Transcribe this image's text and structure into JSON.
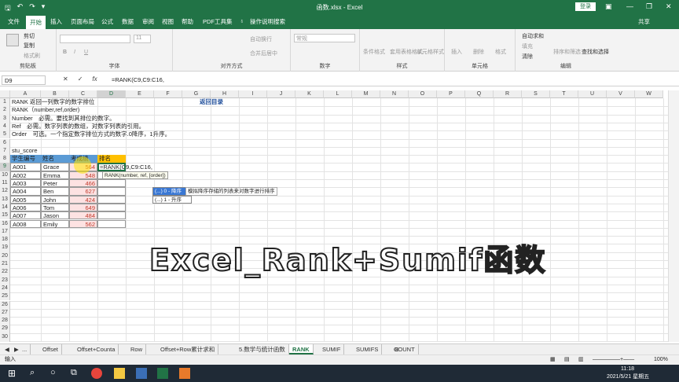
{
  "titlebar": {
    "file_title": "函数.xlsx - Excel",
    "login": "登录"
  },
  "ribbon_tabs": [
    "文件",
    "开始",
    "插入",
    "页面布局",
    "公式",
    "数据",
    "审阅",
    "视图",
    "帮助",
    "PDF工具集",
    "操作说明搜索",
    "共享"
  ],
  "ribbon": {
    "clipboard": {
      "label": "剪贴板",
      "cut": "剪切",
      "copy": "复制",
      "painter": "格式刷"
    },
    "font": {
      "label": "字体",
      "bold": "B",
      "italic": "I",
      "underline": "U",
      "size": "11"
    },
    "align": {
      "label": "对齐方式",
      "wrap": "自动换行",
      "merge": "合并后居中"
    },
    "number": {
      "label": "数字",
      "format": "常规"
    },
    "styles": {
      "label": "样式",
      "cond": "条件格式",
      "table": "套用表格格式",
      "cell": "单元格样式"
    },
    "cells": {
      "label": "单元格",
      "insert": "插入",
      "delete": "删除",
      "format": "格式"
    },
    "editing": {
      "label": "编辑",
      "autosum": "自动求和",
      "fill": "填充",
      "clear": "清除",
      "sort": "排序和筛选",
      "find": "查找和选择"
    }
  },
  "formula_bar": {
    "name_box": "D9",
    "formula": "=RANK(C9,C9:C16,"
  },
  "columns": [
    "A",
    "B",
    "C",
    "D",
    "E",
    "F",
    "G",
    "H",
    "I",
    "J",
    "K",
    "L",
    "M",
    "N",
    "O",
    "P",
    "Q",
    "R",
    "S",
    "T",
    "U",
    "V",
    "W"
  ],
  "rows": [
    "1",
    "2",
    "3",
    "4",
    "5",
    "6",
    "7",
    "8",
    "9",
    "10",
    "11",
    "12",
    "13",
    "14",
    "15",
    "16",
    "17",
    "18",
    "19",
    "20",
    "21",
    "22",
    "23",
    "24",
    "25",
    "26",
    "27",
    "28",
    "29",
    "30",
    "31"
  ],
  "notes": [
    "RANK 返回一列数字的数字排位",
    "RANK（number,ref,order)",
    "Number　必需。要找到其排位的数字。",
    "Ref　必需。数字列表的数组，对数字列表的引用。",
    "Order　可选。一个指定数字排位方式的数字.0降序，1升序。"
  ],
  "return_link": "返回目录",
  "table_name": "stu_score",
  "table": {
    "headers": [
      "学生编号",
      "姓名",
      "考成绩",
      "排名"
    ],
    "rows": [
      [
        "A001",
        "Grace",
        "564",
        "=RANK(C9,C9:C16,"
      ],
      [
        "A002",
        "Emma",
        "548",
        ""
      ],
      [
        "A003",
        "Peter",
        "466",
        ""
      ],
      [
        "A004",
        "Ben",
        "627",
        ""
      ],
      [
        "A005",
        "John",
        "424",
        ""
      ],
      [
        "A006",
        "Tom",
        "649",
        ""
      ],
      [
        "A007",
        "Jason",
        "484",
        ""
      ],
      [
        "A008",
        "Emily",
        "562",
        ""
      ]
    ]
  },
  "tooltip": {
    "signature": "RANK(number, ref, [order])",
    "options": [
      "(...) 0 - 降序",
      "(...) 1 - 升序"
    ],
    "description": "模拟降序存储的列表来对数字进行排序"
  },
  "overlay_title": "Excel_Rank+Sumif函数",
  "sheet_tabs": [
    "...",
    "Offset",
    "Offset+Counta",
    "Row",
    "Offset+Row累计求和",
    "5.数学与统计函数",
    "RANK",
    "SUMIF",
    "SUMIFS",
    "COUNT"
  ],
  "status": {
    "mode": "输入",
    "zoom": "100%"
  },
  "taskbar": {
    "time": "11:18",
    "date": "2021/5/21 星期五"
  },
  "colors": {
    "excel_green": "#217346",
    "header_blue": "#5b9bd5",
    "rank_orange": "#ffc000",
    "score_pink": "#fde2e2"
  }
}
